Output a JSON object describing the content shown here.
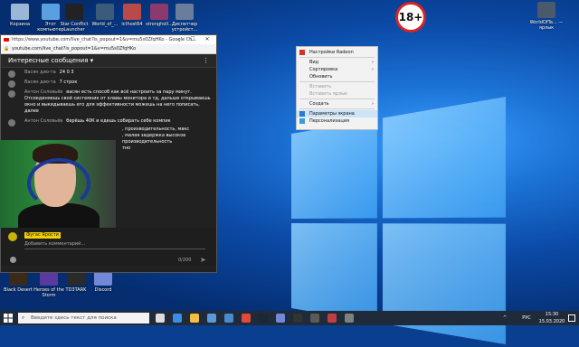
{
  "desktop": {
    "icons_top": [
      {
        "label": "Корзина",
        "color": "#9ab7d8"
      },
      {
        "label": "Этот компьютер",
        "color": "#5aa0e0"
      },
      {
        "label": "Star Conflict Launcher",
        "color": "#222222"
      },
      {
        "label": "World_of_...",
        "color": "#3c5a7a"
      },
      {
        "label": "icthost64",
        "color": "#b84a4a"
      },
      {
        "label": "strongholl...",
        "color": "#8b3a6b"
      },
      {
        "label": "Диспетчер устройст...",
        "color": "#6a7d9a"
      }
    ],
    "icon_right": {
      "label": "WorldOfTa... — ярлык",
      "color": "#4a5a6a"
    },
    "icons_bottom": [
      {
        "label": "Black Desert",
        "color": "#3a2a1a"
      },
      {
        "label": "Heroes of the Storm",
        "color": "#5a3aa0"
      },
      {
        "label": "TD3TARK",
        "color": "#2a2a2a"
      },
      {
        "label": "Discord",
        "color": "#7289da"
      }
    ],
    "badge": "18+"
  },
  "context_menu": {
    "items": [
      {
        "label": "Настройки Radeon",
        "disabled": false,
        "submenu": false,
        "icon": "radeon-icon"
      },
      {
        "label": "Вид",
        "disabled": false,
        "submenu": true
      },
      {
        "label": "Сортировка",
        "disabled": false,
        "submenu": true
      },
      {
        "label": "Обновить",
        "disabled": false,
        "submenu": false
      },
      {
        "label": "Вставить",
        "disabled": true,
        "submenu": false
      },
      {
        "label": "Вставить ярлык",
        "disabled": true,
        "submenu": false
      },
      {
        "label": "Создать",
        "disabled": false,
        "submenu": true
      },
      {
        "label": "Параметры экрана",
        "disabled": false,
        "submenu": false,
        "icon": "display-icon"
      },
      {
        "label": "Персонализация",
        "disabled": false,
        "submenu": false,
        "icon": "personalize-icon"
      }
    ]
  },
  "browser": {
    "title": "https://www.youtube.com/live_chat?is_popout=1&v=mu5s0ZfqHKo - Google Ch...",
    "url": "youtube.com/live_chat?is_popout=1&v=mu5s0ZfqHKo",
    "chat_title": "Интересные сообщения",
    "messages": [
      {
        "author": "Васян дио-та",
        "text": "24 0 3"
      },
      {
        "author": "Васян дио-та",
        "text": "7 строк"
      },
      {
        "author": "Антон Соловьёв",
        "text": "васян есть способ как всё настроить за пару минут. Отсоединяешь свой системник от клавы монитора и тд, дальше открываешь окно и выкидываешь его для эффективности можешь на него пописать, далее"
      },
      {
        "author": "Антон Соловьёв",
        "text": "берёшь 40К и едешь собирать себе компик"
      },
      {
        "author": "",
        "text": ", производительность, макс"
      },
      {
        "author": "",
        "text": ", малая задержка высокое"
      },
      {
        "author": "",
        "text": "производительность"
      },
      {
        "author": "",
        "text": "тно"
      }
    ],
    "channel_badge": "Фугас Ярости",
    "input_placeholder": "Добавить комментарий...",
    "char_count": "0/200"
  },
  "taskbar": {
    "search_placeholder": "Введите здесь текст для поиска",
    "apps": [
      {
        "name": "task-view-icon",
        "color": "#dddddd"
      },
      {
        "name": "edge-icon",
        "color": "#3a8ee6"
      },
      {
        "name": "explorer-icon",
        "color": "#f0c040"
      },
      {
        "name": "store-icon",
        "color": "#5a9ad8"
      },
      {
        "name": "mail-icon",
        "color": "#4a8ad0"
      },
      {
        "name": "chrome-icon",
        "color": "#e04a3a"
      },
      {
        "name": "steam-icon",
        "color": "#1b2838"
      },
      {
        "name": "discord-icon",
        "color": "#7289da"
      },
      {
        "name": "obs-icon",
        "color": "#333333"
      },
      {
        "name": "app-icon",
        "color": "#5a5a5a"
      },
      {
        "name": "app2-icon",
        "color": "#c04040"
      },
      {
        "name": "app3-icon",
        "color": "#808080"
      }
    ],
    "lang": "РУС",
    "time": "15:30",
    "date": "15.03.2020"
  }
}
